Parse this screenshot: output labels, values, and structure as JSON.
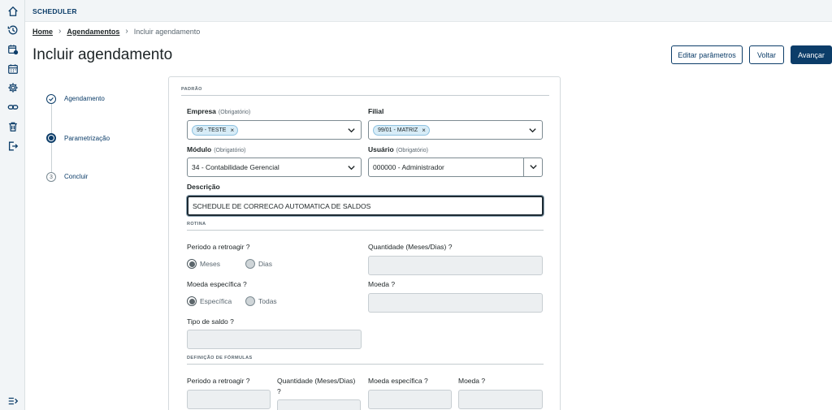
{
  "app": {
    "title": "SCHEDULER"
  },
  "sidebar": {
    "icons": [
      "home-icon",
      "history-icon",
      "calendar-add-icon",
      "calendar-icon",
      "gear-icon",
      "link-icon",
      "trash-icon",
      "logout-icon",
      "expand-menu-icon"
    ]
  },
  "breadcrumb": {
    "home": "Home",
    "section": "Agendamentos",
    "current": "Incluir agendamento"
  },
  "page": {
    "title": "Incluir agendamento"
  },
  "actions": {
    "edit_params": "Editar parâmetros",
    "back": "Voltar",
    "next": "Avançar"
  },
  "stepper": {
    "steps": [
      {
        "label": "Agendamento",
        "state": "done"
      },
      {
        "label": "Parametrização",
        "state": "active"
      },
      {
        "label": "Concluir",
        "state": "todo",
        "number": "3"
      }
    ]
  },
  "form": {
    "section_padrao": "PADRÃO",
    "empresa": {
      "label": "Empresa",
      "optional": "(Obrigatório)",
      "chip": "99 - TESTE"
    },
    "filial": {
      "label": "Filial",
      "chip": "99/01 - MATRIZ"
    },
    "modulo": {
      "label": "Módulo",
      "optional": "(Obrigatório)",
      "value": "34 - Contabilidade Gerencial"
    },
    "usuario": {
      "label": "Usuário",
      "optional": "(Obrigatório)",
      "value": "000000 - Administrador"
    },
    "descricao": {
      "label": "Descrição",
      "value": "SCHEDULE DE CORRECAO AUTOMATICA DE SALDOS"
    },
    "section_rotina": "ROTINA",
    "periodo": {
      "label": "Periodo a retroagir ?",
      "opt1": "Meses",
      "opt2": "Dias"
    },
    "quantidade": {
      "label": "Quantidade (Meses/Dias) ?"
    },
    "moeda_especifica": {
      "label": "Moeda específica ?",
      "opt1": "Específica",
      "opt2": "Todas"
    },
    "moeda": {
      "label": "Moeda ?"
    },
    "tipo_saldo": {
      "label": "Tipo de saldo ?"
    },
    "section_formulas": "DEFINIÇÃO DE FÓRMULAS",
    "f_periodo": {
      "label": "Periodo a retroagir ?"
    },
    "f_quantidade": {
      "label": "Quantidade (Meses/Dias)",
      "label2": "?"
    },
    "f_moeda_especifica": {
      "label": "Moeda específica ?"
    },
    "f_moeda": {
      "label": "Moeda ?"
    }
  }
}
